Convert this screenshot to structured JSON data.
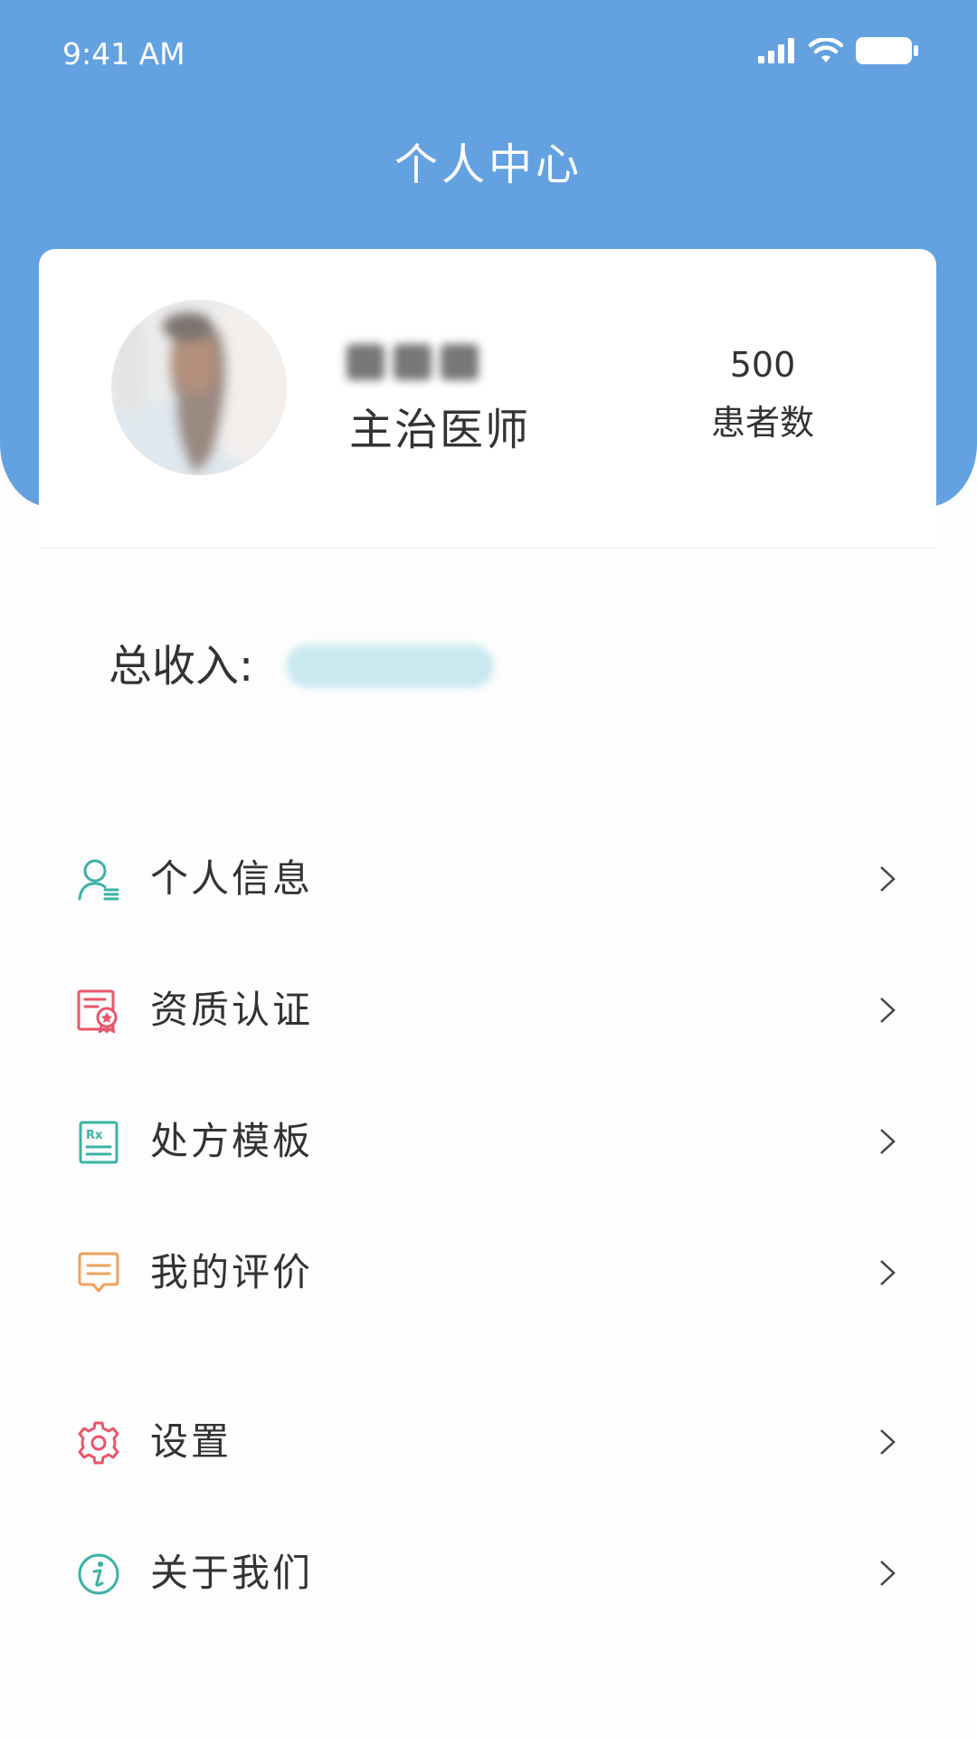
{
  "status_bar": {
    "time": "9:41 AM"
  },
  "header": {
    "title": "个人中心",
    "background_color": "#63a1e1"
  },
  "profile": {
    "title": "主治医师",
    "patient_count": "500",
    "patient_count_label": "患者数"
  },
  "income": {
    "label": "总收入:"
  },
  "menu": {
    "items": [
      {
        "label": "个人信息",
        "icon": "person-info-icon",
        "icon_color": "#3bb2a4"
      },
      {
        "label": "资质认证",
        "icon": "certificate-icon",
        "icon_color": "#e8566b"
      },
      {
        "label": "处方模板",
        "icon": "prescription-icon",
        "icon_color": "#3bb2a4"
      },
      {
        "label": "我的评价",
        "icon": "comment-icon",
        "icon_color": "#f0a15a"
      },
      {
        "label": "设置",
        "icon": "gear-icon",
        "icon_color": "#e8566b"
      },
      {
        "label": "关于我们",
        "icon": "info-icon",
        "icon_color": "#3bb2a4"
      }
    ]
  }
}
